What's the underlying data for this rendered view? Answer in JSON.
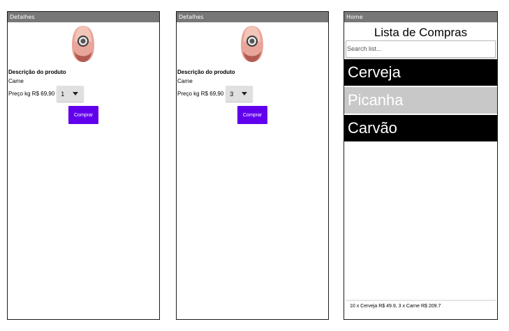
{
  "screen1": {
    "title": "Detalhes",
    "description_label": "Descrição do produto",
    "description_value": "Carne",
    "price_label": "Preço kg R$ 69,90",
    "quantity": "1",
    "buy_label": "Comprar"
  },
  "screen2": {
    "title": "Detalhes",
    "description_label": "Descrição do produto",
    "description_value": "Carne",
    "price_label": "Preço kg R$ 69,90",
    "quantity": "3",
    "buy_label": "Comprar"
  },
  "screen3": {
    "title": "Home",
    "list_title": "Lista de Compras",
    "search_placeholder": "Search list...",
    "items": [
      {
        "label": "Cerveja",
        "selected": false
      },
      {
        "label": "Picanha",
        "selected": true
      },
      {
        "label": "Carvão",
        "selected": false
      }
    ],
    "summary": "10 x Cerveja R$ 49.9, 3 x Carne R$ 209.7"
  },
  "colors": {
    "titlebar": "#777777",
    "button": "#6200ee",
    "list_item_bg": "#000000",
    "list_item_selected_bg": "#c8c8c8"
  }
}
